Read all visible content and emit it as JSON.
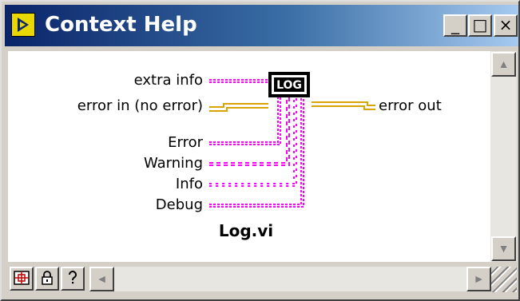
{
  "window": {
    "title": "Context Help",
    "controls": {
      "minimize": "_",
      "maximize": "□",
      "close": "×"
    }
  },
  "connector": {
    "vi_name": "Log.vi",
    "icon_text": "LOG",
    "inputs": [
      "extra info",
      "error in (no error)",
      "Error",
      "Warning",
      "Info",
      "Debug"
    ],
    "outputs": [
      "error out"
    ]
  },
  "toolbar": {
    "buttons": [
      {
        "name": "show-optional-terminals",
        "icon": "connector-pane-icon"
      },
      {
        "name": "lock-context-help",
        "icon": "lock-icon"
      },
      {
        "name": "detailed-help",
        "icon": "question-mark-icon"
      }
    ]
  },
  "colors": {
    "title_start": "#0a246a",
    "title_end": "#a6caf0",
    "error_wire": "#d9a400",
    "string_wire": "#ff00ff"
  }
}
